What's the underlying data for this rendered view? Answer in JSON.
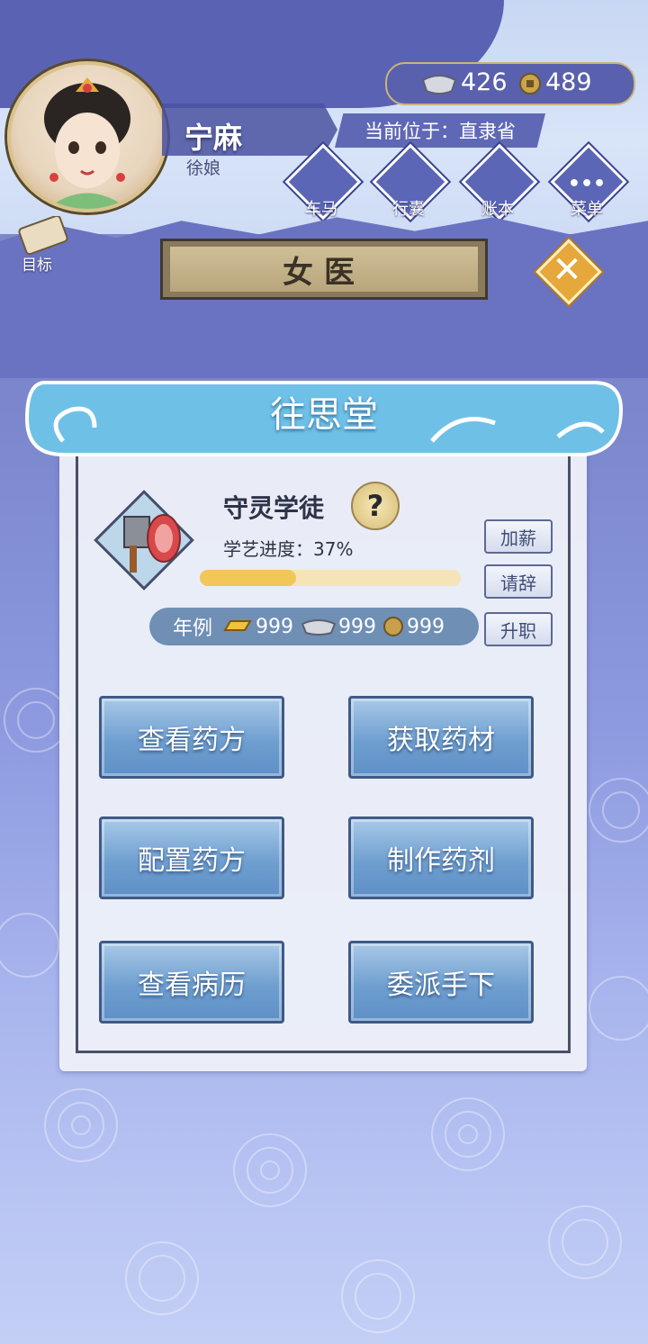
{
  "player": {
    "name": "宁麻",
    "title": "徐娘"
  },
  "currency": {
    "silver": "426",
    "coins": "489"
  },
  "location": {
    "text": "当前位于：直隶省"
  },
  "nav": [
    {
      "label": "车马",
      "icon": "carriage-icon"
    },
    {
      "label": "行囊",
      "icon": "bag-icon"
    },
    {
      "label": "账本",
      "icon": "ledger-icon"
    },
    {
      "label": "菜单",
      "icon": "menu-icon"
    }
  ],
  "goal": {
    "label": "目标"
  },
  "page": {
    "title": "女医",
    "hall_name": "往思堂"
  },
  "job": {
    "title": "守灵学徒",
    "progress_label": "学艺进度：37%",
    "progress": 0.37,
    "salary_label": "年例",
    "salary_gold": "999",
    "salary_silver": "999",
    "salary_coin": "999"
  },
  "side_buttons": {
    "raise": "加薪",
    "resign": "请辞",
    "promote": "升职"
  },
  "actions": [
    {
      "label": "查看药方"
    },
    {
      "label": "获取药材"
    },
    {
      "label": "配置药方"
    },
    {
      "label": "制作药剂"
    },
    {
      "label": "查看病历"
    },
    {
      "label": "委派手下"
    }
  ],
  "colors": {
    "accent": "#f3c65a",
    "panel": "#eceff8",
    "button": "#6f9fd0",
    "close": "#e6a83b"
  }
}
